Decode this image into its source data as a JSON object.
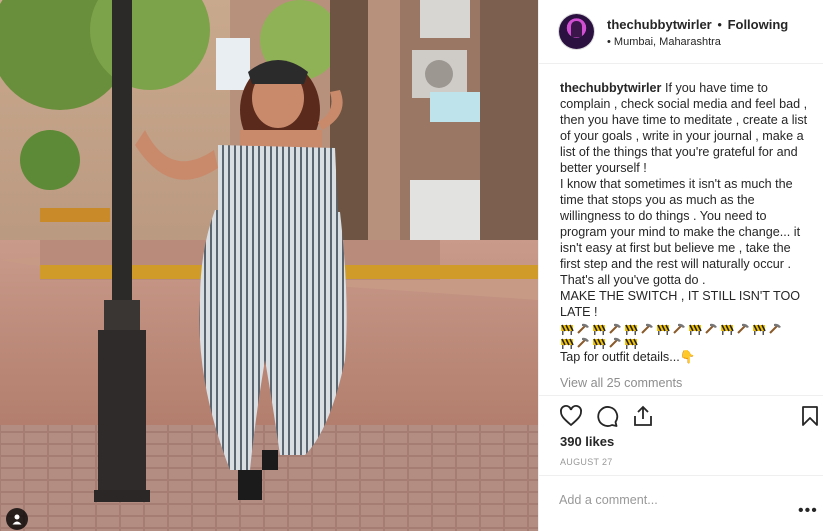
{
  "post": {
    "username": "thechubbytwirler",
    "separator": "•",
    "follow_label": "Following",
    "location": "Mumbai, Maharashtra",
    "location_bullet": "•"
  },
  "caption": {
    "username": "thechubbytwirler",
    "para1": "If you have time to complain , check social media and feel bad , then you have time to meditate , create a list of your goals , write in your journal , make a list of the things that you're grateful for and better yourself !",
    "para2": "I know that sometimes it isn't as much the time that stops you as much as the willingness to do things . You need to program your mind to make the change... it isn't easy at first but believe me , take the first step and the rest will naturally occur . That's all you've gotta do .",
    "para3": "MAKE THE SWITCH , IT STILL ISN'T TOO LATE !",
    "emoji_row": [
      "construction-sign",
      "hammer-pick",
      "construction-sign",
      "hammer-pick",
      "construction-sign",
      "hammer-pick",
      "construction-sign",
      "hammer-pick",
      "construction-sign",
      "hammer-pick",
      "construction-sign",
      "hammer-pick",
      "construction-sign",
      "hammer-pick",
      "construction-sign",
      "hammer-pick",
      "construction-sign",
      "hammer-pick",
      "construction-sign"
    ],
    "outfit_line": "Tap for outfit details...",
    "outfit_emoji": "👇"
  },
  "comments": {
    "view_all": "View all 25 comments"
  },
  "actions": {
    "icons": [
      "heart-icon",
      "comment-icon",
      "share-icon",
      "bookmark-icon"
    ]
  },
  "stats": {
    "likes": "390 likes",
    "date": "AUGUST 27"
  },
  "comment_box": {
    "placeholder": "Add a comment...",
    "more": "•••"
  },
  "colors": {
    "text": "#262626",
    "muted": "#8e8e8e",
    "border": "#efefef",
    "emoji_yellow": "#f4c400"
  }
}
